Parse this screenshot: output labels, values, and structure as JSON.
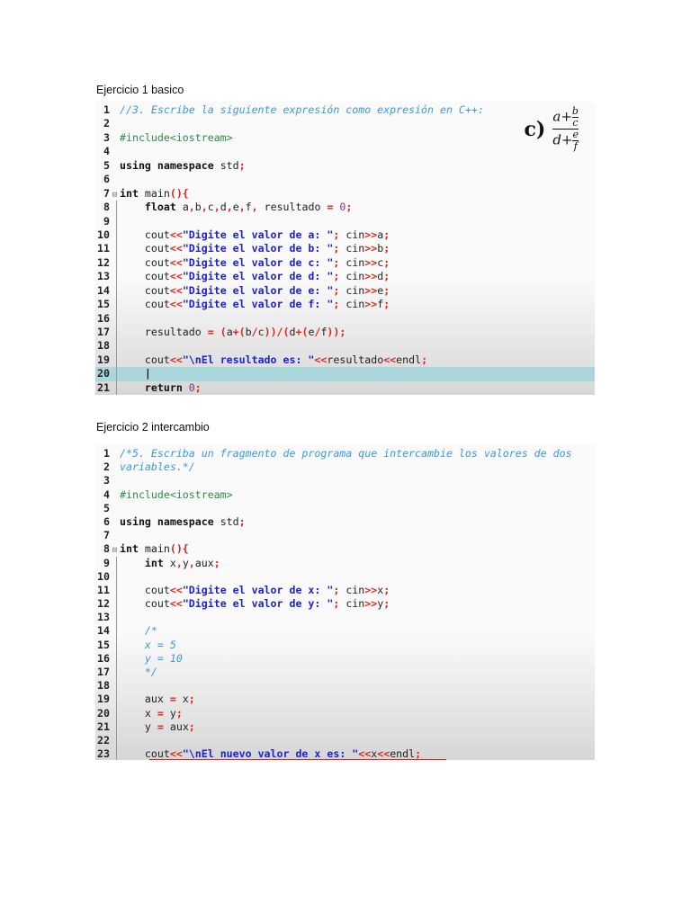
{
  "exercise1": {
    "heading": "Ejercicio 1 basico",
    "formula": {
      "label": "c)",
      "num_a": "a+",
      "num_b": "b",
      "num_c": "c",
      "den_d": "d+",
      "den_e": "e",
      "den_f": "f"
    },
    "highlighted_line": 20,
    "fold_line": 7,
    "lines": [
      [
        [
          "//3. Escribe la siguiente expresión como expresión en C++:",
          "c"
        ]
      ],
      [],
      [
        [
          "#include<iostream>",
          "p"
        ]
      ],
      [],
      [
        [
          "using namespace ",
          "k"
        ],
        [
          "std",
          "t"
        ],
        [
          ";",
          "o"
        ]
      ],
      [],
      [
        [
          "int ",
          "k"
        ],
        [
          "main",
          "t"
        ],
        [
          "(){",
          "o"
        ]
      ],
      [
        [
          "    float ",
          "k"
        ],
        [
          "a",
          "t"
        ],
        [
          ",",
          "o"
        ],
        [
          "b",
          "t"
        ],
        [
          ",",
          "o"
        ],
        [
          "c",
          "t"
        ],
        [
          ",",
          "o"
        ],
        [
          "d",
          "t"
        ],
        [
          ",",
          "o"
        ],
        [
          "e",
          "t"
        ],
        [
          ",",
          "o"
        ],
        [
          "f",
          "t"
        ],
        [
          ",",
          "o"
        ],
        [
          " resultado ",
          "t"
        ],
        [
          "=",
          "o"
        ],
        [
          " ",
          "t"
        ],
        [
          "0",
          "n"
        ],
        [
          ";",
          "o"
        ]
      ],
      [],
      [
        [
          "    cout",
          "t"
        ],
        [
          "<<",
          "o"
        ],
        [
          "\"Digite el valor de a: \"",
          "s"
        ],
        [
          "; ",
          "o"
        ],
        [
          "cin",
          "t"
        ],
        [
          ">>",
          "o"
        ],
        [
          "a",
          "t"
        ],
        [
          ";",
          "o"
        ]
      ],
      [
        [
          "    cout",
          "t"
        ],
        [
          "<<",
          "o"
        ],
        [
          "\"Digite el valor de b: \"",
          "s"
        ],
        [
          "; ",
          "o"
        ],
        [
          "cin",
          "t"
        ],
        [
          ">>",
          "o"
        ],
        [
          "b",
          "t"
        ],
        [
          ";",
          "o"
        ]
      ],
      [
        [
          "    cout",
          "t"
        ],
        [
          "<<",
          "o"
        ],
        [
          "\"Digite el valor de c: \"",
          "s"
        ],
        [
          "; ",
          "o"
        ],
        [
          "cin",
          "t"
        ],
        [
          ">>",
          "o"
        ],
        [
          "c",
          "t"
        ],
        [
          ";",
          "o"
        ]
      ],
      [
        [
          "    cout",
          "t"
        ],
        [
          "<<",
          "o"
        ],
        [
          "\"Digite el valor de d: \"",
          "s"
        ],
        [
          "; ",
          "o"
        ],
        [
          "cin",
          "t"
        ],
        [
          ">>",
          "o"
        ],
        [
          "d",
          "t"
        ],
        [
          ";",
          "o"
        ]
      ],
      [
        [
          "    cout",
          "t"
        ],
        [
          "<<",
          "o"
        ],
        [
          "\"Digite el valor de e: \"",
          "s"
        ],
        [
          "; ",
          "o"
        ],
        [
          "cin",
          "t"
        ],
        [
          ">>",
          "o"
        ],
        [
          "e",
          "t"
        ],
        [
          ";",
          "o"
        ]
      ],
      [
        [
          "    cout",
          "t"
        ],
        [
          "<<",
          "o"
        ],
        [
          "\"Digite el valor de f: \"",
          "s"
        ],
        [
          "; ",
          "o"
        ],
        [
          "cin",
          "t"
        ],
        [
          ">>",
          "o"
        ],
        [
          "f",
          "t"
        ],
        [
          ";",
          "o"
        ]
      ],
      [],
      [
        [
          "    resultado ",
          "t"
        ],
        [
          "= (",
          "o"
        ],
        [
          "a",
          "t"
        ],
        [
          "+(",
          "o"
        ],
        [
          "b",
          "t"
        ],
        [
          "/",
          "o"
        ],
        [
          "c",
          "t"
        ],
        [
          "))/(",
          "o"
        ],
        [
          "d",
          "t"
        ],
        [
          "+(",
          "o"
        ],
        [
          "e",
          "t"
        ],
        [
          "/",
          "o"
        ],
        [
          "f",
          "t"
        ],
        [
          "));",
          "o"
        ]
      ],
      [],
      [
        [
          "    cout",
          "t"
        ],
        [
          "<<",
          "o"
        ],
        [
          "\"\\nEl resultado es: \"",
          "s"
        ],
        [
          "<<",
          "o"
        ],
        [
          "resultado",
          "t"
        ],
        [
          "<<",
          "o"
        ],
        [
          "endl",
          "t"
        ],
        [
          ";",
          "o"
        ]
      ],
      [
        [
          "    |",
          "k"
        ]
      ],
      [
        [
          "    return ",
          "k"
        ],
        [
          "0",
          "n"
        ],
        [
          ";",
          "o"
        ]
      ]
    ]
  },
  "exercise2": {
    "heading": "Ejercicio 2  intercambio",
    "fold_line": 8,
    "lines": [
      [
        [
          "/*5. Escriba un fragmento de programa que intercambie los valores de dos",
          "c"
        ]
      ],
      [
        [
          "variables.*/",
          "c"
        ]
      ],
      [],
      [
        [
          "#include<iostream>",
          "p"
        ]
      ],
      [],
      [
        [
          "using namespace ",
          "k"
        ],
        [
          "std",
          "t"
        ],
        [
          ";",
          "o"
        ]
      ],
      [],
      [
        [
          "int ",
          "k"
        ],
        [
          "main",
          "t"
        ],
        [
          "(){",
          "o"
        ]
      ],
      [
        [
          "    int ",
          "k"
        ],
        [
          "x",
          "t"
        ],
        [
          ",",
          "o"
        ],
        [
          "y",
          "t"
        ],
        [
          ",",
          "o"
        ],
        [
          "aux",
          "t"
        ],
        [
          ";",
          "o"
        ]
      ],
      [],
      [
        [
          "    cout",
          "t"
        ],
        [
          "<<",
          "o"
        ],
        [
          "\"Digite el valor de x: \"",
          "s"
        ],
        [
          "; ",
          "o"
        ],
        [
          "cin",
          "t"
        ],
        [
          ">>",
          "o"
        ],
        [
          "x",
          "t"
        ],
        [
          ";",
          "o"
        ]
      ],
      [
        [
          "    cout",
          "t"
        ],
        [
          "<<",
          "o"
        ],
        [
          "\"Digite el valor de y: \"",
          "s"
        ],
        [
          "; ",
          "o"
        ],
        [
          "cin",
          "t"
        ],
        [
          ">>",
          "o"
        ],
        [
          "y",
          "t"
        ],
        [
          ";",
          "o"
        ]
      ],
      [],
      [
        [
          "    /*",
          "c"
        ]
      ],
      [
        [
          "    x = 5",
          "c"
        ]
      ],
      [
        [
          "    y = 10",
          "c"
        ]
      ],
      [
        [
          "    */",
          "c"
        ]
      ],
      [],
      [
        [
          "    aux ",
          "t"
        ],
        [
          "=",
          "o"
        ],
        [
          " x",
          "t"
        ],
        [
          ";",
          "o"
        ]
      ],
      [
        [
          "    x ",
          "t"
        ],
        [
          "=",
          "o"
        ],
        [
          " y",
          "t"
        ],
        [
          ";",
          "o"
        ]
      ],
      [
        [
          "    y ",
          "t"
        ],
        [
          "=",
          "o"
        ],
        [
          " aux",
          "t"
        ],
        [
          ";",
          "o"
        ]
      ],
      [],
      [
        [
          "    cout",
          "t"
        ],
        [
          "<<",
          "o"
        ],
        [
          "\"\\nEl nuevo valor de x es: \"",
          "s"
        ],
        [
          "<<",
          "o"
        ],
        [
          "x",
          "t"
        ],
        [
          "<<",
          "o"
        ],
        [
          "endl",
          "t"
        ],
        [
          ";",
          "o"
        ]
      ]
    ]
  }
}
